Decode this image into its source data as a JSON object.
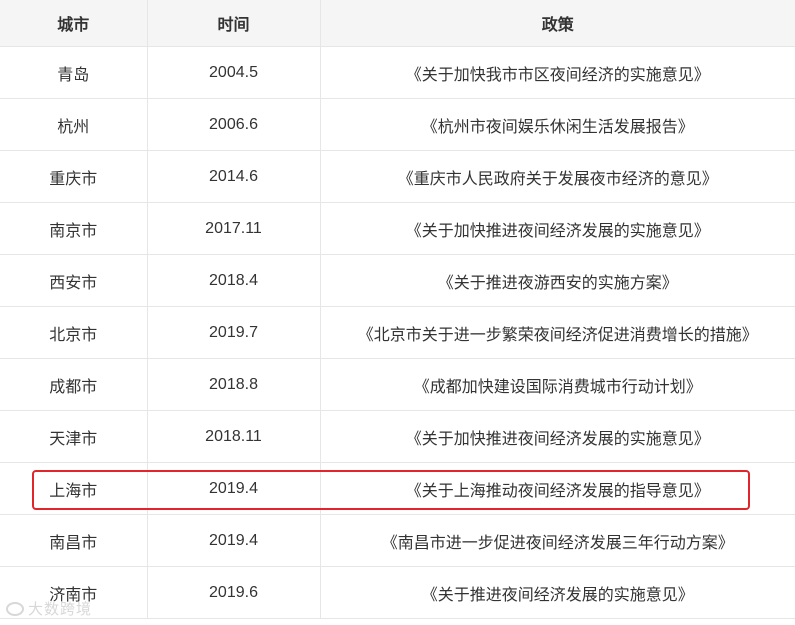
{
  "table": {
    "headers": [
      "城市",
      "时间",
      "政策"
    ],
    "rows": [
      {
        "city": "青岛",
        "time": "2004.5",
        "policy": "《关于加快我市市区夜间经济的实施意见》"
      },
      {
        "city": "杭州",
        "time": "2006.6",
        "policy": "《杭州市夜间娱乐休闲生活发展报告》"
      },
      {
        "city": "重庆市",
        "time": "2014.6",
        "policy": "《重庆市人民政府关于发展夜市经济的意见》"
      },
      {
        "city": "南京市",
        "time": "2017.11",
        "policy": "《关于加快推进夜间经济发展的实施意见》"
      },
      {
        "city": "西安市",
        "time": "2018.4",
        "policy": "《关于推进夜游西安的实施方案》"
      },
      {
        "city": "北京市",
        "time": "2019.7",
        "policy": "《北京市关于进一步繁荣夜间经济促进消费增长的措施》"
      },
      {
        "city": "成都市",
        "time": "2018.8",
        "policy": "《成都加快建设国际消费城市行动计划》"
      },
      {
        "city": "天津市",
        "time": "2018.11",
        "policy": "《关于加快推进夜间经济发展的实施意见》"
      },
      {
        "city": "上海市",
        "time": "2019.4",
        "policy": "《关于上海推动夜间经济发展的指导意见》"
      },
      {
        "city": "南昌市",
        "time": "2019.4",
        "policy": "《南昌市进一步促进夜间经济发展三年行动方案》"
      },
      {
        "city": "济南市",
        "time": "2019.6",
        "policy": "《关于推进夜间经济发展的实施意见》"
      }
    ]
  },
  "highlight": {
    "color": "#e0262a",
    "row_index": 8
  },
  "watermark": {
    "text": "大数跨境"
  }
}
